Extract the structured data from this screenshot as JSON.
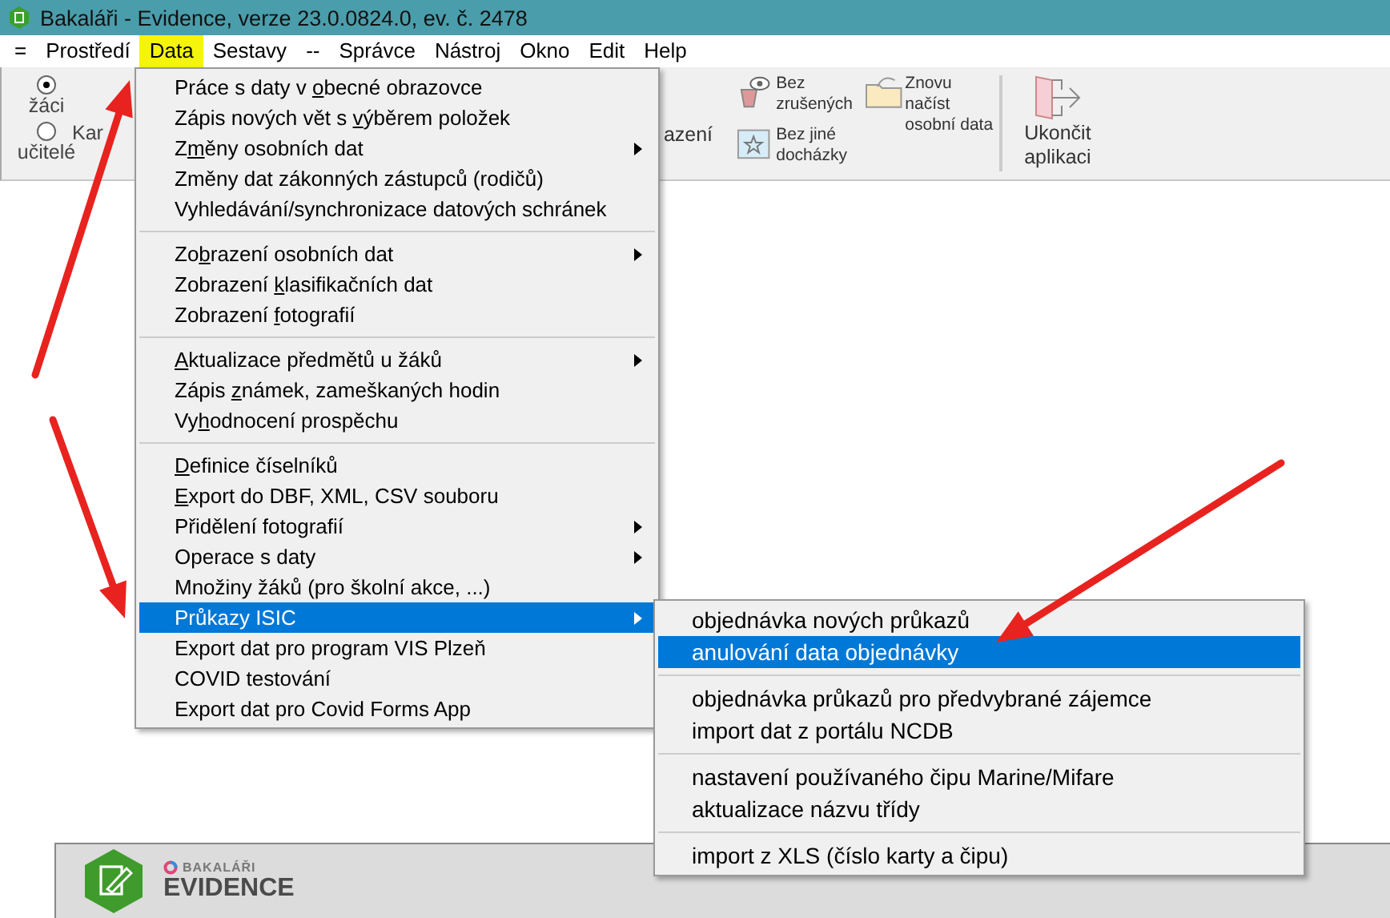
{
  "window": {
    "title": "Bakaláři - Evidence, verze 23.0.0824.0, ev. č. 2478"
  },
  "menubar": [
    {
      "label": "=",
      "selected": false
    },
    {
      "label": "Prostředí",
      "selected": false
    },
    {
      "label": "Data",
      "selected": true
    },
    {
      "label": "Sestavy",
      "selected": false
    },
    {
      "label": "--",
      "selected": false
    },
    {
      "label": "Správce",
      "selected": false
    },
    {
      "label": "Nástroj",
      "selected": false
    },
    {
      "label": "Okno",
      "selected": false
    },
    {
      "label": "Edit",
      "selected": false
    },
    {
      "label": "Help",
      "selected": false
    }
  ],
  "toolbar": {
    "radios": [
      {
        "label": "žáci",
        "selected": true
      },
      {
        "label": "učitelé",
        "selected": false
      }
    ],
    "partial_left": "Kar",
    "partial_right": "azení",
    "filters": [
      {
        "label": "Bez zrušených"
      },
      {
        "label": "Bez jiné docházky"
      }
    ],
    "reload": "Znovu načíst osobní data",
    "exit": "Ukončit aplikaci"
  },
  "data_menu": [
    [
      {
        "before": "Práce s daty v ",
        "hotkey": "o",
        "after": "becné obrazovce",
        "submenu": false,
        "selected": false
      },
      {
        "before": "Zápis nových vět s ",
        "hotkey": "v",
        "after": "ýběrem položek",
        "submenu": false,
        "selected": false
      },
      {
        "before": "Z",
        "hotkey": "m",
        "after": "ěny osobních dat",
        "submenu": true,
        "selected": false
      },
      {
        "before": "Změny dat zákonných zástupců (rodičů)",
        "submenu": false,
        "selected": false
      },
      {
        "before": "Vyhledávání/synchronizace datových schránek",
        "submenu": false,
        "selected": false
      }
    ],
    [
      {
        "before": "Zo",
        "hotkey": "b",
        "after": "razení osobních dat",
        "submenu": true,
        "selected": false
      },
      {
        "before": "Zobrazení ",
        "hotkey": "k",
        "after": "lasifikačních dat",
        "submenu": false,
        "selected": false
      },
      {
        "before": "Zobrazení ",
        "hotkey": "f",
        "after": "otografií",
        "submenu": false,
        "selected": false
      }
    ],
    [
      {
        "hotkey": "A",
        "after": "ktualizace předmětů u žáků",
        "submenu": true,
        "selected": false
      },
      {
        "before": "Zápis ",
        "hotkey": "z",
        "after": "námek, zameškaných hodin",
        "submenu": false,
        "selected": false
      },
      {
        "before": "Vy",
        "hotkey": "h",
        "after": "odnocení prospěchu",
        "submenu": false,
        "selected": false
      }
    ],
    [
      {
        "hotkey": "D",
        "after": "efinice číselníků",
        "submenu": false,
        "selected": false
      },
      {
        "hotkey": "E",
        "after": "xport do DBF,  XML, CSV souboru",
        "submenu": false,
        "selected": false
      },
      {
        "before": "Přidělení fotografií",
        "submenu": true,
        "selected": false
      },
      {
        "before": "Operace s daty",
        "submenu": true,
        "selected": false
      },
      {
        "before": "Množiny žáků (pro školní akce, ...)",
        "submenu": false,
        "selected": false
      },
      {
        "before": "Průkazy ISIC",
        "submenu": true,
        "selected": true
      },
      {
        "before": "Export dat pro program VIS Plzeň",
        "submenu": false,
        "selected": false
      },
      {
        "before": "COVID testování",
        "submenu": false,
        "selected": false
      },
      {
        "before": "Export dat pro Covid Forms App",
        "submenu": false,
        "selected": false
      }
    ]
  ],
  "isic_menu": [
    [
      {
        "label": "objednávka nových průkazů",
        "selected": false
      },
      {
        "label": "anulování data objednávky",
        "selected": true
      }
    ],
    [
      {
        "label": "objednávka průkazů pro předvybrané zájemce",
        "selected": false
      },
      {
        "label": "import dat z portálu NCDB",
        "selected": false
      }
    ],
    [
      {
        "label": "nastavení používaného čipu Marine/Mifare",
        "selected": false
      },
      {
        "label": "aktualizace názvu třídy",
        "selected": false
      }
    ],
    [
      {
        "label": "import z XLS (číslo karty a čipu)",
        "selected": false
      }
    ]
  ],
  "footer": {
    "brand": "BAKALÁŘI",
    "product": "EVIDENCE"
  }
}
